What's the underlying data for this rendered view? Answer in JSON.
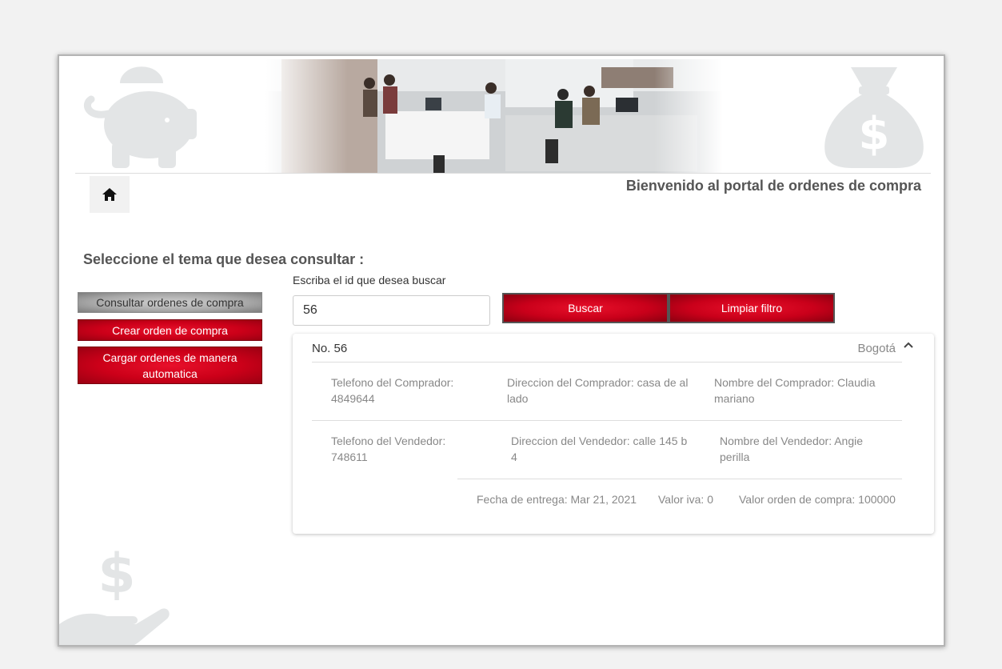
{
  "header": {
    "welcome": "Bienvenido al portal de ordenes de compra"
  },
  "icons": {
    "home": "home-icon",
    "piggy": "piggy-bank-icon",
    "moneybag": "money-bag-icon",
    "hand": "dollar-hand-icon",
    "chevron": "chevron-up-icon"
  },
  "sidebar": {
    "title": "Seleccione el tema que desea consultar :",
    "items": [
      {
        "label": "Consultar ordenes de compra",
        "active": true
      },
      {
        "label": "Crear orden de compra",
        "active": false
      },
      {
        "label": "Cargar ordenes de manera automatica",
        "active": false
      }
    ]
  },
  "search": {
    "label": "Escriba el id que desea buscar",
    "value": "56",
    "search_button": "Buscar",
    "clear_button": "Limpiar filtro"
  },
  "order": {
    "number": "No. 56",
    "city": "Bogotá",
    "buyer_phone": "Telefono del Comprador: 4849644",
    "buyer_address": "Direccion del Comprador: casa de al lado",
    "buyer_name": "Nombre del Comprador: Claudia mariano",
    "seller_phone": "Telefono del Vendedor: 748611",
    "seller_address": "Direccion del Vendedor: calle 145 b 4",
    "seller_name": "Nombre del Vendedor: Angie perilla",
    "delivery": "Fecha de entrega: Mar 21, 2021",
    "iva": "Valor iva: 0",
    "total": "Valor orden de compra: 100000"
  },
  "colors": {
    "primary_red": "#cc0019",
    "active_gray": "#a8a8a8",
    "decor_gray": "#e3e5e6"
  }
}
